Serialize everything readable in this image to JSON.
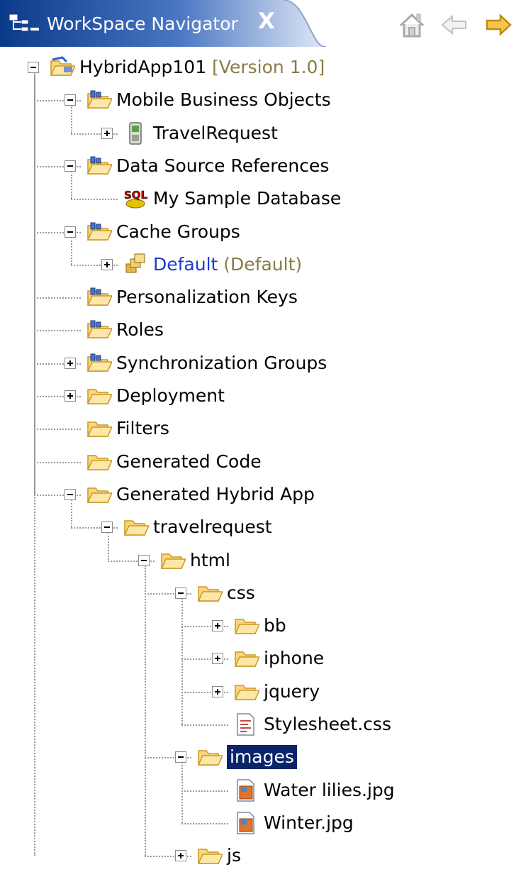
{
  "view": {
    "title": "WorkSpace Navigator",
    "close_glyph": "X",
    "toolbar": [
      {
        "icon": "home-icon",
        "tip": "Home"
      },
      {
        "icon": "back-arrow-icon",
        "tip": "Back"
      },
      {
        "icon": "forward-arrow-icon",
        "tip": "Forward"
      }
    ]
  },
  "tree": [
    {
      "depth": 0,
      "label": "HybridApp101",
      "suffix": " [Version 1.0]",
      "icon": "project-folder-icon",
      "expander": "minus"
    },
    {
      "depth": 1,
      "label": "Mobile Business Objects",
      "icon": "sup-folder-icon",
      "expander": "minus"
    },
    {
      "depth": 2,
      "label": "TravelRequest",
      "icon": "mobile-device-icon",
      "expander": "plus"
    },
    {
      "depth": 1,
      "label": "Data Source References",
      "icon": "sup-folder-icon",
      "expander": "minus"
    },
    {
      "depth": 2,
      "label": "My Sample Database",
      "icon": "sql-database-icon",
      "expander": "none"
    },
    {
      "depth": 1,
      "label": "Cache Groups",
      "icon": "sup-folder-icon",
      "expander": "minus"
    },
    {
      "depth": 2,
      "label": "Default",
      "suffix": " (Default)",
      "icon": "cache-group-icon",
      "expander": "plus",
      "style": "blue"
    },
    {
      "depth": 1,
      "label": "Personalization Keys",
      "icon": "sup-folder-icon",
      "expander": "none"
    },
    {
      "depth": 1,
      "label": "Roles",
      "icon": "sup-folder-icon",
      "expander": "none"
    },
    {
      "depth": 1,
      "label": "Synchronization Groups",
      "icon": "sup-folder-icon",
      "expander": "plus"
    },
    {
      "depth": 1,
      "label": "Deployment",
      "icon": "folder-icon",
      "expander": "plus"
    },
    {
      "depth": 1,
      "label": "Filters",
      "icon": "folder-icon",
      "expander": "none"
    },
    {
      "depth": 1,
      "label": "Generated Code",
      "icon": "folder-icon",
      "expander": "none"
    },
    {
      "depth": 1,
      "label": "Generated Hybrid App",
      "icon": "folder-icon",
      "expander": "minus"
    },
    {
      "depth": 2,
      "label": "travelrequest",
      "icon": "folder-icon",
      "expander": "minus"
    },
    {
      "depth": 3,
      "label": "html",
      "icon": "folder-icon",
      "expander": "minus"
    },
    {
      "depth": 4,
      "label": "css",
      "icon": "folder-icon",
      "expander": "minus"
    },
    {
      "depth": 5,
      "label": "bb",
      "icon": "folder-icon",
      "expander": "plus"
    },
    {
      "depth": 5,
      "label": "iphone",
      "icon": "folder-icon",
      "expander": "plus"
    },
    {
      "depth": 5,
      "label": "jquery",
      "icon": "folder-icon",
      "expander": "plus"
    },
    {
      "depth": 5,
      "label": "Stylesheet.css",
      "icon": "css-file-icon",
      "expander": "none"
    },
    {
      "depth": 4,
      "label": "images",
      "icon": "folder-icon",
      "expander": "minus",
      "style": "selected"
    },
    {
      "depth": 5,
      "label": "Water lilies.jpg",
      "icon": "image-file-icon",
      "expander": "none"
    },
    {
      "depth": 5,
      "label": "Winter.jpg",
      "icon": "image-file-icon",
      "expander": "none"
    },
    {
      "depth": 4,
      "label": "js",
      "icon": "folder-icon",
      "expander": "plus"
    }
  ],
  "colors": {
    "tab_gradient_start": "#0a3a8a",
    "tab_gradient_end": "#d5e1f3",
    "selection": "#0a246a",
    "hint_text": "#8b7b46",
    "link_text": "#1b3ccf",
    "folder_fill": "#fbd57a",
    "folder_stroke": "#c99a25"
  }
}
